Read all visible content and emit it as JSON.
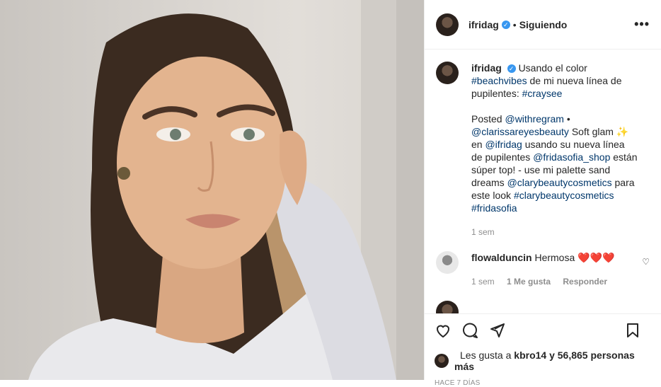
{
  "post": {
    "username": "ifridag",
    "follow_status": "Siguiendo",
    "caption_intro": "Usando el color",
    "caption_hashtag1": "#beachvibes",
    "caption_mid": "de mi nueva línea de pupilentes:",
    "caption_hashtag2": "#craysee",
    "posted_label": "Posted",
    "mention1": "@withregram",
    "bullet": "•",
    "mention2": "@clarissareyesbeauty",
    "text2": "Soft glam ✨ en",
    "mention3": "@ifridag",
    "text3": "usando su nueva línea de pupilentes",
    "mention4": "@fridasofia_shop",
    "text4": "están súper top! - use mi palette sand dreams",
    "mention5": "@clarybeautycosmetics",
    "text5": "para este look",
    "hashtag3": "#clarybeautycosmetics",
    "hashtag4": "#fridasofia",
    "time": "1 sem"
  },
  "comment": {
    "username": "flowalduncin",
    "text": "Hermosa",
    "hearts": "❤️❤️❤️",
    "time": "1 sem",
    "likes": "1 Me gusta",
    "reply": "Responder"
  },
  "footer": {
    "likes_prefix": "Les gusta a",
    "likes_user": "kbro14",
    "likes_suffix": "y 56,865 personas más",
    "ago": "HACE 7 DÍAS"
  }
}
